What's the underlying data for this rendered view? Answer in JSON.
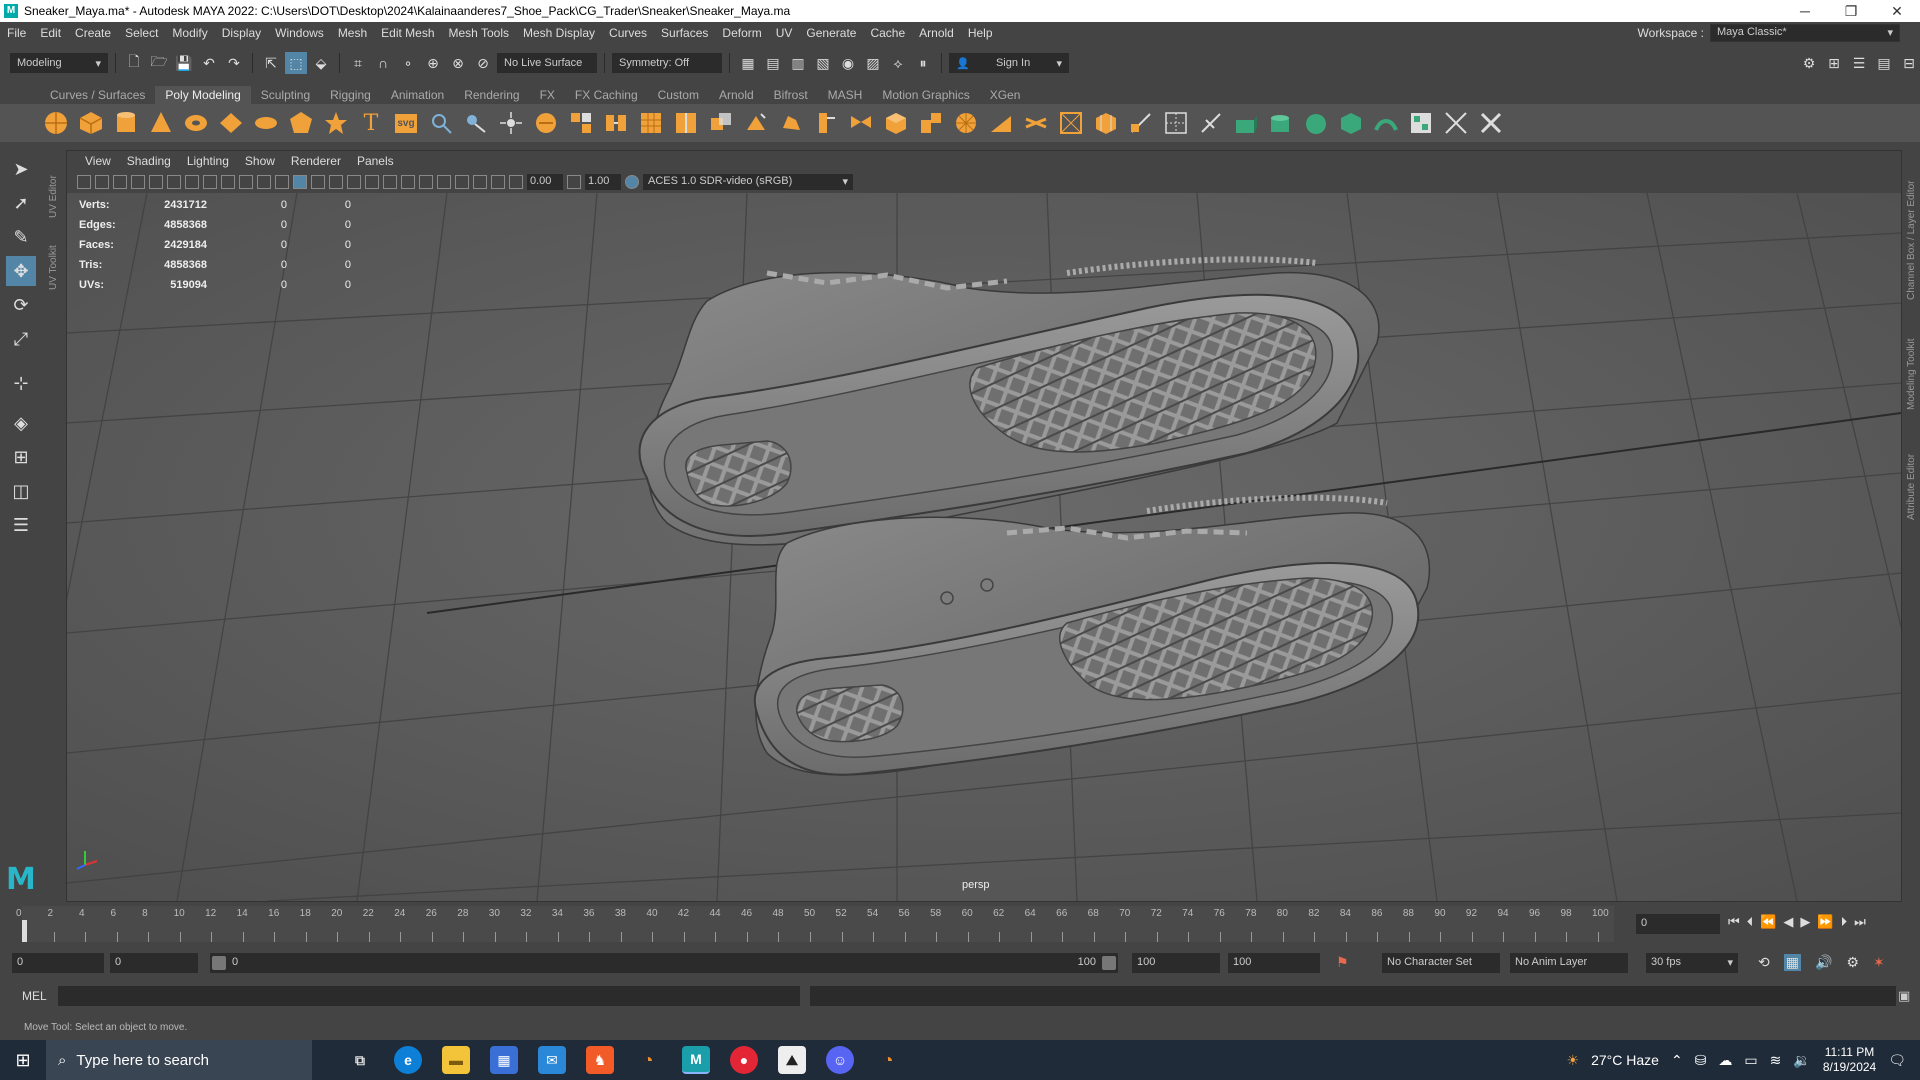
{
  "window": {
    "title": "Sneaker_Maya.ma* - Autodesk MAYA 2022: C:\\Users\\DOT\\Desktop\\2024\\Kalainaanderes7_Shoe_Pack\\CG_Trader\\Sneaker\\Sneaker_Maya.ma",
    "app_icon": "M",
    "minimize": "─",
    "restore": "❐",
    "close": "✕"
  },
  "menubar": {
    "items": [
      "File",
      "Edit",
      "Create",
      "Select",
      "Modify",
      "Display",
      "Windows",
      "Mesh",
      "Edit Mesh",
      "Mesh Tools",
      "Mesh Display",
      "Curves",
      "Surfaces",
      "Deform",
      "UV",
      "Generate",
      "Cache",
      "Arnold",
      "Help"
    ],
    "workspace_label": "Workspace :",
    "workspace_value": "Maya Classic*"
  },
  "statusline": {
    "menuset": "Modeling",
    "live_surface": "No Live Surface",
    "symmetry": "Symmetry: Off",
    "sign_in": "Sign In"
  },
  "shelf": {
    "tabs": [
      "Curves / Surfaces",
      "Poly Modeling",
      "Sculpting",
      "Rigging",
      "Animation",
      "Rendering",
      "FX",
      "FX Caching",
      "Custom",
      "Arnold",
      "Bifrost",
      "MASH",
      "Motion Graphics",
      "XGen"
    ],
    "active_tab": "Poly Modeling",
    "text_icon": "T",
    "svg_icon": "svg"
  },
  "panel": {
    "menus": [
      "View",
      "Shading",
      "Lighting",
      "Show",
      "Renderer",
      "Panels"
    ],
    "exposure": "0.00",
    "gamma": "1.00",
    "color_space": "ACES 1.0 SDR-video (sRGB)",
    "camera": "persp"
  },
  "hud": {
    "rows": [
      {
        "label": "Verts:",
        "value": "2431712",
        "a": "0",
        "b": "0"
      },
      {
        "label": "Edges:",
        "value": "4858368",
        "a": "0",
        "b": "0"
      },
      {
        "label": "Faces:",
        "value": "2429184",
        "a": "0",
        "b": "0"
      },
      {
        "label": "Tris:",
        "value": "4858368",
        "a": "0",
        "b": "0"
      },
      {
        "label": "UVs:",
        "value": "519094",
        "a": "0",
        "b": "0"
      }
    ]
  },
  "side_tabs": {
    "left": [
      "UV Editor",
      "UV Toolkit"
    ],
    "right": [
      "Channel Box / Layer Editor",
      "Modeling Toolkit",
      "Attribute Editor"
    ]
  },
  "timeline": {
    "ticks": [
      "0",
      "2",
      "4",
      "6",
      "8",
      "10",
      "12",
      "14",
      "16",
      "18",
      "20",
      "22",
      "24",
      "26",
      "28",
      "30",
      "32",
      "34",
      "36",
      "38",
      "40",
      "42",
      "44",
      "46",
      "48",
      "50",
      "52",
      "54",
      "56",
      "58",
      "60",
      "62",
      "64",
      "66",
      "68",
      "70",
      "72",
      "74",
      "76",
      "78",
      "80",
      "82",
      "84",
      "86",
      "88",
      "90",
      "92",
      "94",
      "96",
      "98",
      "100"
    ],
    "current_frame": "0"
  },
  "range": {
    "start": "0",
    "anim_start": "0",
    "range_start": "0",
    "range_end": "100",
    "anim_end": "100",
    "end": "100",
    "character_set": "No Character Set",
    "anim_layer": "No Anim Layer",
    "fps": "30 fps"
  },
  "cmdline": {
    "label": "MEL"
  },
  "helpline": {
    "text": "Move Tool: Select an object to move."
  },
  "taskbar": {
    "search_placeholder": "Type here to search",
    "weather": "27°C  Haze",
    "time": "11:11 PM",
    "date": "8/19/2024",
    "apps": [
      "task-view",
      "edge",
      "file-explorer",
      "store",
      "mail",
      "brave",
      "blender",
      "maya",
      "app-red",
      "app-photo",
      "discord",
      "blender-2"
    ]
  },
  "colors": {
    "maya_blue": "#5285a6",
    "viewport_bg": "#5a5a5a",
    "shelf_orange": "#f0a13a",
    "shelf_green": "#3aa87a"
  }
}
